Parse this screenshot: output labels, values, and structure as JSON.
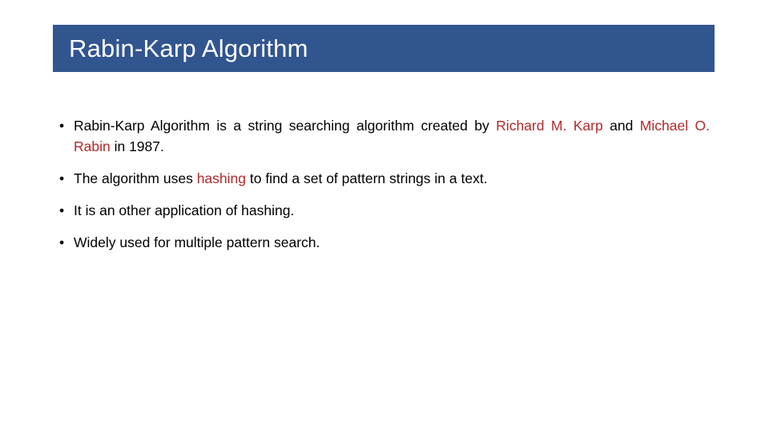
{
  "slide": {
    "title": "Rabin-Karp Algorithm",
    "banner_color": "#31558F",
    "title_color": "#FFFFFF",
    "background_color": "#FFFFFF",
    "highlight_color": "#B02A2A",
    "body_color": "#000000"
  },
  "bullets": [
    {
      "marker": "•",
      "segments": [
        {
          "text": "Rabin-Karp Algorithm is a string searching algorithm created by ",
          "highlight": false
        },
        {
          "text": "Richard M. Karp",
          "highlight": true
        },
        {
          "text": " and ",
          "highlight": false
        },
        {
          "text": "Michael O. Rabin",
          "highlight": true
        },
        {
          "text": " in 1987.",
          "highlight": false
        }
      ],
      "justify": true
    },
    {
      "marker": "•",
      "segments": [
        {
          "text": "The algorithm uses ",
          "highlight": false
        },
        {
          "text": "hashing",
          "highlight": true
        },
        {
          "text": " to find a set of pattern strings in a text.",
          "highlight": false
        }
      ],
      "justify": false
    },
    {
      "marker": "•",
      "segments": [
        {
          "text": "It is an other application of hashing.",
          "highlight": false
        }
      ],
      "justify": false
    },
    {
      "marker": "•",
      "segments": [
        {
          "text": "Widely used for multiple pattern search.",
          "highlight": false
        }
      ],
      "justify": false
    }
  ]
}
